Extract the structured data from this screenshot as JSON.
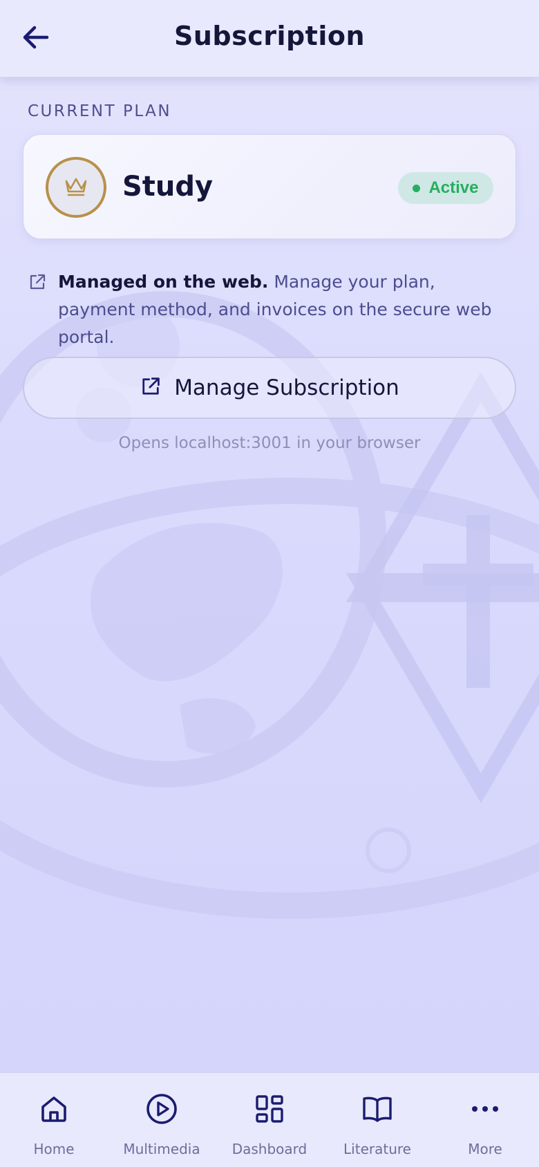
{
  "header": {
    "title": "Subscription",
    "back_icon": "arrow-left-icon"
  },
  "current_plan": {
    "section_label": "CURRENT PLAN",
    "plan_icon": "crown-icon",
    "plan_name": "Study",
    "status": "Active",
    "status_color": "#27ae60"
  },
  "notice": {
    "icon": "external-link-icon",
    "bold_text": "Managed on the web.",
    "text": " Manage your plan, payment method, and invoices on the secure web portal."
  },
  "manage_button": {
    "icon": "external-link-icon",
    "label": "Manage Subscription",
    "hint": "Opens localhost:3001 in your browser"
  },
  "tabbar": {
    "items": [
      {
        "label": "Home",
        "icon": "home-icon"
      },
      {
        "label": "Multimedia",
        "icon": "play-circle-icon"
      },
      {
        "label": "Dashboard",
        "icon": "dashboard-grid-icon"
      },
      {
        "label": "Literature",
        "icon": "open-book-icon"
      },
      {
        "label": "More",
        "icon": "more-dots-icon"
      }
    ]
  },
  "colors": {
    "primary": "#14163a",
    "accent_gold": "#b7914a",
    "background": "#dcdcfd"
  }
}
